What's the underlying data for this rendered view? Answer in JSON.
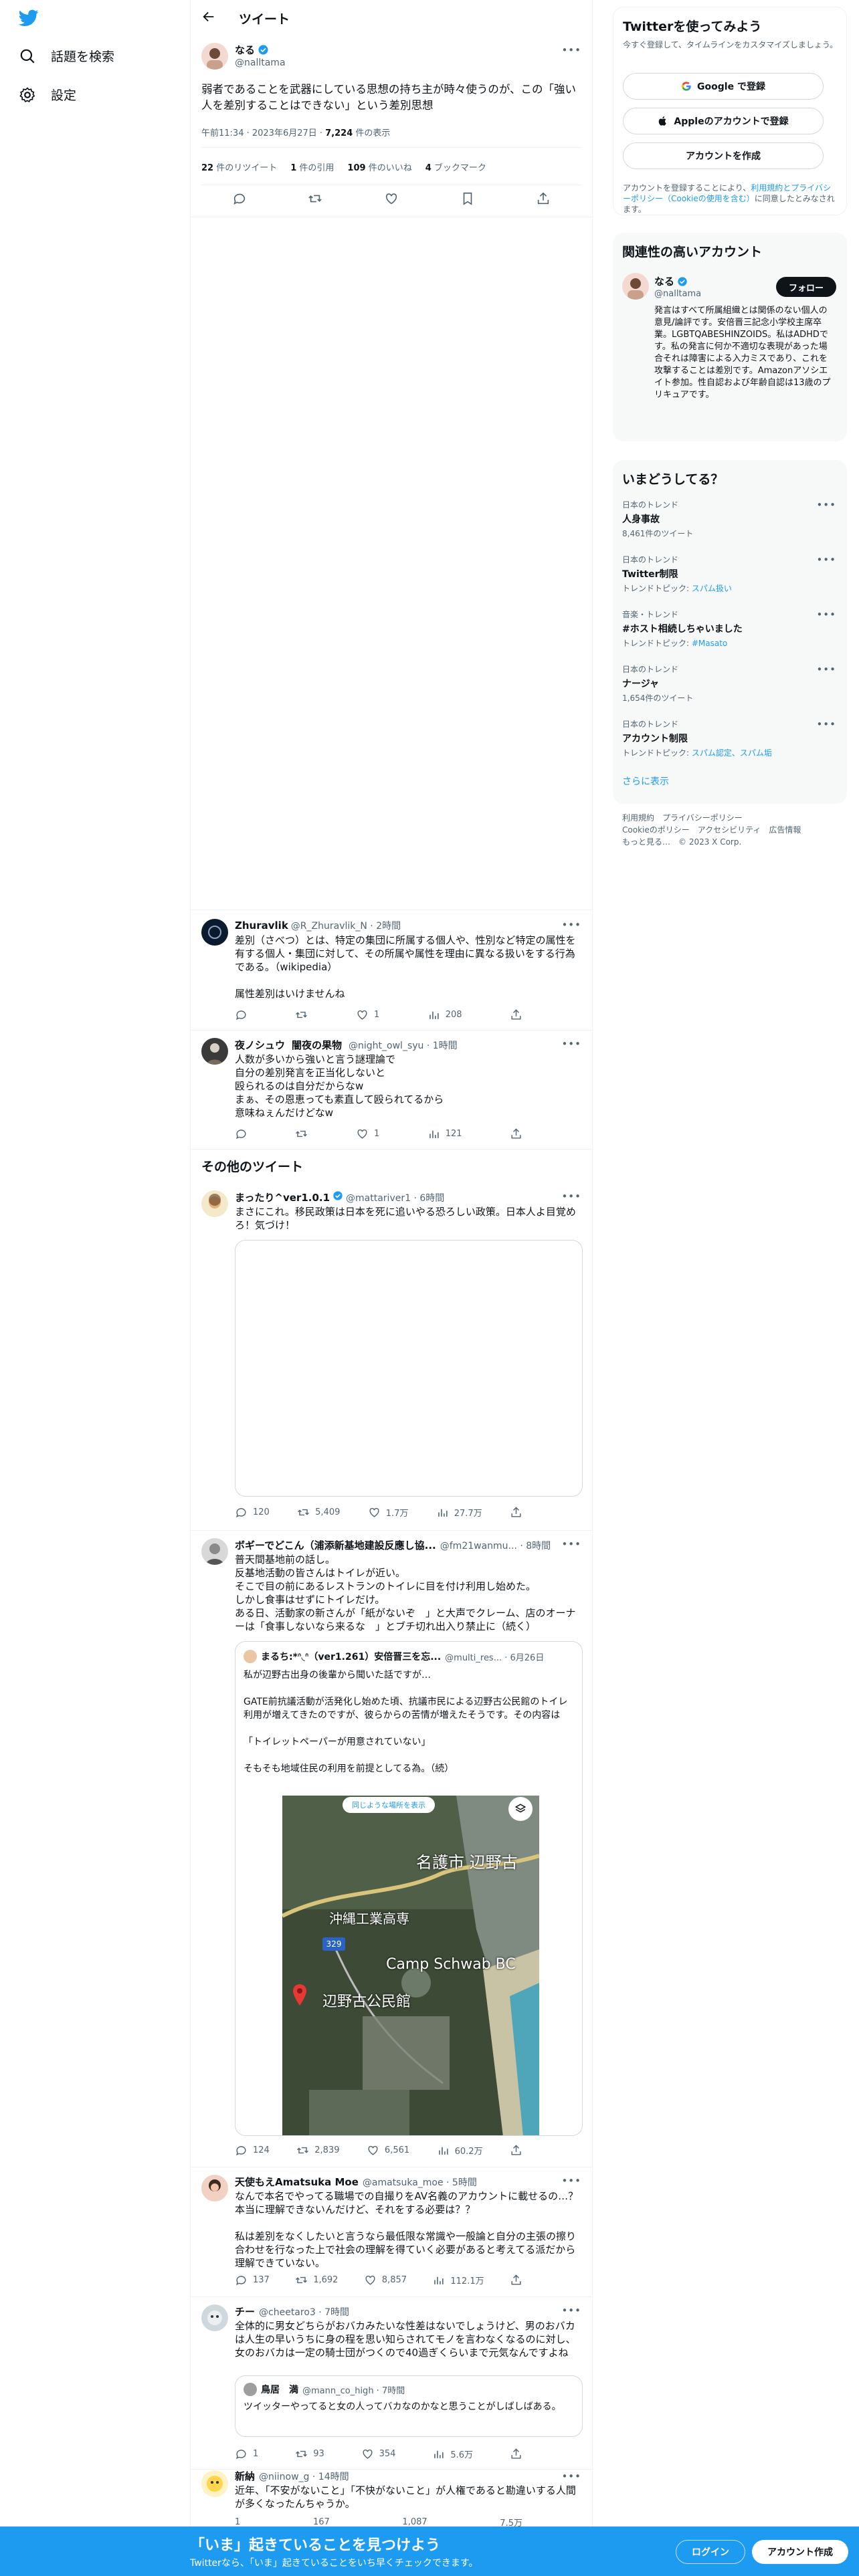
{
  "nav": {
    "explore_label": "話題を検索",
    "settings_label": "設定"
  },
  "header": {
    "title": "ツイート"
  },
  "main_tweet": {
    "name": "なる",
    "handle": "@nalltama",
    "text": "弱者であることを武器にしている思想の持ち主が時々使うのが、この「強い人を差別することはできない」という差別思想",
    "time": "午前11:34 · 2023年6月27日 · ",
    "views_count": "7,224",
    "views_label": " 件の表示",
    "stats": {
      "retweets_count": "22",
      "retweets_label": " 件のリツイート",
      "quotes_count": "1",
      "quotes_label": " 件の引用",
      "likes_count": "109",
      "likes_label": " 件のいいね",
      "bookmarks_count": "4",
      "bookmarks_label": " ブックマーク"
    }
  },
  "replies": [
    {
      "name": "Zhuravlik",
      "handle": "@R_Zhuravlik_N · 2時間",
      "text": "差別（さべつ）とは、特定の集団に所属する個人や、性別など特定の属性を有する個人・集団に対して、その所属や属性を理由に異なる扱いをする行為である。（wikipedia）\n\n属性差別はいけませんね",
      "like": "1",
      "views": "208"
    },
    {
      "name": "夜ノシュウ",
      "name2": "闇夜の果物",
      "handle": "@night_owl_syu · 1時間",
      "text": "人数が多いから強いと言う謎理論で\n自分の差別発言を正当化しないと\n殴られるのは自分だからなw\nまぁ、その恩恵っても素直して殴られてるから\n意味ねぇんだけどなw",
      "like": "1",
      "views": "121"
    }
  ],
  "other_section_title": "その他のツイート",
  "other_tweets": [
    {
      "name": "まったり^ver1.0.1",
      "handle": "@mattariver1 · 6時間",
      "text": "まさにこれ。移民政策は日本を死に追いやる恐ろしい政策。日本人よ目覚めろ！気づけ！",
      "reply": "120",
      "retweet": "5,409",
      "like": "1.7万",
      "views": "27.7万"
    },
    {
      "name": "ボギーでどこん（浦添新基地建設反應し協...",
      "handle": "@fm21wanmu... · 8時間",
      "text": "普天間基地前の話し。\n反基地活動の皆さんはトイレが近い。\nそこで目の前にあるレストランのトイレに目を付け利用し始めた。\nしかし食事はせずにトイレだけ。\nある日、活動家の新さんが「紙がないぞ　」と大声でクレーム、店のオーナーは「食事しないなら来るな　」とブチ切れ出入り禁止に（続く）",
      "quote": {
        "name": "まるち:*ᐢ◟ᐢ（ver1.261）安倍晋三を忘...",
        "handle": "@multi_res... · 6月26日",
        "text": "私が辺野古出身の後輩から聞いた話ですが…\n\nGATE前抗議活動が活発化し始めた頃、抗議市民による辺野古公民館のトイレ利用が増えてきたのですが、彼らからの苦情が増えたそうです。その内容は\n\n「トイレットペーパーが用意されていない」\n\nそもそも地域住民の利用を前提としてる為。（続）"
      },
      "map_labels": {
        "hint": "同じような場所を表示",
        "nago": "名護市 辺野古",
        "school": "沖縄工業高専",
        "camp": "Camp Schwab BC",
        "hall": "辺野古公民館",
        "route": "329"
      },
      "reply": "124",
      "retweet": "2,839",
      "like": "6,561",
      "views": "60.2万"
    },
    {
      "name": "天使もえAmatsuka Moe",
      "handle": "@amatsuka_moe · 5時間",
      "text": "なんで本名でやってる職場での自撮りをAV名義のアカウントに載せるの…？本当に理解できないんだけど、それをする必要は？？\n\n私は差別をなくしたいと言うなら最低限な常識や一般論と自分の主張の擦り合わせを行なった上で社会の理解を得ていく必要があると考えてる派だから理解できていない。",
      "reply": "137",
      "retweet": "1,692",
      "like": "8,857",
      "views": "112.1万"
    },
    {
      "name": "チー",
      "handle": "@cheetaro3 · 7時間",
      "text": "全体的に男女どちらがおバカみたいな性差はないでしょうけど、男のおバカは人生の早いうちに身の程を思い知らされてモノを言わなくなるのに対し、女のおバカは一定の騎士団がつくので40過ぎくらいまで元気なんですよね",
      "quote": {
        "name": "鳥居　満",
        "handle": "@mann_co_high · 7時間",
        "text": "ツイッターやってると女の人ってバカなのかなと思うことがしばしばある。"
      },
      "reply": "1",
      "retweet": "93",
      "like": "354",
      "views": "5.6万"
    },
    {
      "name": "新納",
      "handle": "@niinow_g · 14時間",
      "text": "近年、「不安がないこと」「不快がないこと」が人権であると勘違いする人間が多くなったんちゃうか。",
      "reply": "1",
      "retweet": "167",
      "like": "1,087",
      "views": "7.5万"
    }
  ],
  "signup_card": {
    "title": "Twitterを使ってみよう",
    "desc": "今すぐ登録して、タイムラインをカスタマイズしましょう。",
    "google": "Google で登録",
    "apple": "Appleのアカウントで登録",
    "create": "アカウントを作成",
    "terms_prefix": "アカウントを登録することにより、",
    "terms_link": "利用規約とプライバシーポリシー（Cookieの使用を含む）",
    "terms_suffix": "に同意したとみなされます。"
  },
  "related": {
    "title": "関連性の高いアカウント",
    "name": "なる",
    "handle": "@nalltama",
    "follow": "フォロー",
    "bio": "発言はすべて所属組織とは関係のない個人の意見/論評です。安倍晋三記念小学校主席卒業。LGBTQABESHINZOIDS。私はADHDです。私の発言に何か不適切な表現があった場合それは障害による入力ミスであり、これを攻撃することは差別です。Amazonアソシエイト参加。性自認および年齢自認は13歳のプリキュアです。"
  },
  "trends": {
    "title": "いまどうしてる？",
    "items": [
      {
        "cat": "日本のトレンド",
        "title": "人身事故",
        "sub": "8,461件のツイート",
        "link": ""
      },
      {
        "cat": "日本のトレンド",
        "title": "Twitter制限",
        "sub": "トレンドトピック: ",
        "link": "スパム扱い"
      },
      {
        "cat": "音楽・トレンド",
        "title": "#ホスト相続しちゃいました",
        "sub": "トレンドトピック: ",
        "link": "#Masato"
      },
      {
        "cat": "日本のトレンド",
        "title": "ナージャ",
        "sub": "1,654件のツイート",
        "link": ""
      },
      {
        "cat": "日本のトレンド",
        "title": "アカウント制限",
        "sub": "トレンドトピック: ",
        "link": "スパム認定、スパム垢"
      }
    ],
    "more": "さらに表示"
  },
  "footer": {
    "line1": "利用規約　プライバシーポリシー",
    "line2": "Cookieのポリシー　アクセシビリティ　広告情報",
    "line3": "もっと見る…　© 2023 X Corp."
  },
  "bottombar": {
    "title": "「いま」起きていることを見つけよう",
    "sub": "Twitterなら、「いま」起きていることをいち早くチェックできます。",
    "login": "ログイン",
    "signup": "アカウント作成"
  },
  "colors": {
    "accent": "#1d9bf0",
    "text": "#0f1419",
    "muted": "#536471"
  }
}
